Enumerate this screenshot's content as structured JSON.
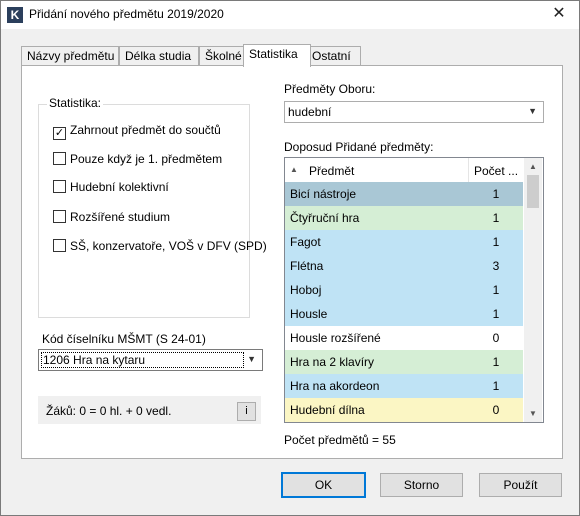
{
  "window": {
    "title": "Přidání nového předmětu 2019/2020",
    "app_icon_letter": "K",
    "close_glyph": "✕"
  },
  "tabs": [
    "Názvy předmětu",
    "Délka studia",
    "Školné",
    "Statistika",
    "Ostatní"
  ],
  "active_tab": "Statistika",
  "statistika": {
    "group_title": "Statistika:",
    "checkboxes": [
      {
        "label": "Zahrnout předmět do součtů",
        "checked": true
      },
      {
        "label": "Pouze když je 1. předmětem",
        "checked": false
      },
      {
        "label": "Hudební kolektivní",
        "checked": false
      },
      {
        "label": "Rozšířené studium",
        "checked": false
      },
      {
        "label": "SŠ, konzervatoře, VOŠ v DFV (SPD)",
        "checked": false
      }
    ]
  },
  "kod": {
    "label": "Kód číselníku MŠMT (S 24-01)",
    "value": "1206 Hra na kytaru"
  },
  "zaku": {
    "text": "Žáků:  0  =  0 hl. + 0 vedl.",
    "button_label": "i"
  },
  "obor": {
    "label": "Předměty Oboru:",
    "value": "hudební"
  },
  "list": {
    "label": "Doposud Přidané předměty:",
    "columns": [
      "Předmět",
      "Počet ..."
    ],
    "rows": [
      {
        "name": "Bicí nástroje",
        "count": "1",
        "color": "#a9c7d5"
      },
      {
        "name": "Čtyřruční hra",
        "count": "1",
        "color": "#d5eed5"
      },
      {
        "name": "Fagot",
        "count": "1",
        "color": "#bfe3f5"
      },
      {
        "name": "Flétna",
        "count": "3",
        "color": "#bfe3f5"
      },
      {
        "name": "Hoboj",
        "count": "1",
        "color": "#bfe3f5"
      },
      {
        "name": "Housle",
        "count": "1",
        "color": "#bfe3f5"
      },
      {
        "name": "Housle rozšířené",
        "count": "0",
        "color": "#ffffff"
      },
      {
        "name": "Hra na 2 klavíry",
        "count": "1",
        "color": "#d5eed5"
      },
      {
        "name": "Hra na akordeon",
        "count": "1",
        "color": "#bfe3f5"
      },
      {
        "name": "Hudební dílna",
        "count": "0",
        "color": "#fbf6c4"
      }
    ],
    "total": "Počet předmětů = 55"
  },
  "buttons": {
    "ok": "OK",
    "storno": "Storno",
    "pouzit": "Použít"
  }
}
